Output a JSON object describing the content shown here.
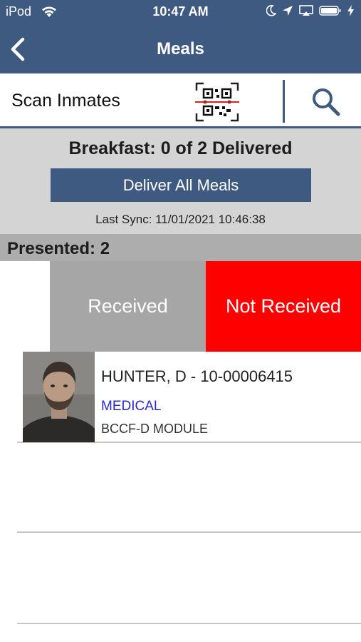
{
  "status_bar": {
    "carrier": "iPod",
    "time": "10:47 AM"
  },
  "nav": {
    "title": "Meals",
    "back_icon": "chevron-left-icon"
  },
  "scan": {
    "label": "Scan Inmates",
    "qr_icon": "qr-scan-icon",
    "search_icon": "search-icon"
  },
  "summary": {
    "meal_status": "Breakfast: 0 of 2 Delivered",
    "deliver_all_label": "Deliver All Meals",
    "last_sync": "Last Sync: 11/01/2021 10:46:38"
  },
  "section": {
    "label": "Presented: 2"
  },
  "swipe_actions": {
    "received_label": "Received",
    "not_received_label": "Not Received"
  },
  "inmates": [
    {
      "name": "HUNTER, D - 10-00006415",
      "diet": "MEDICAL",
      "location": "BCCF-D MODULE"
    }
  ],
  "colors": {
    "brand_blue": "#3f5a80",
    "not_received_red": "#ff0000",
    "received_gray": "#a6a6a6",
    "diet_blue": "#2a2ad0"
  }
}
